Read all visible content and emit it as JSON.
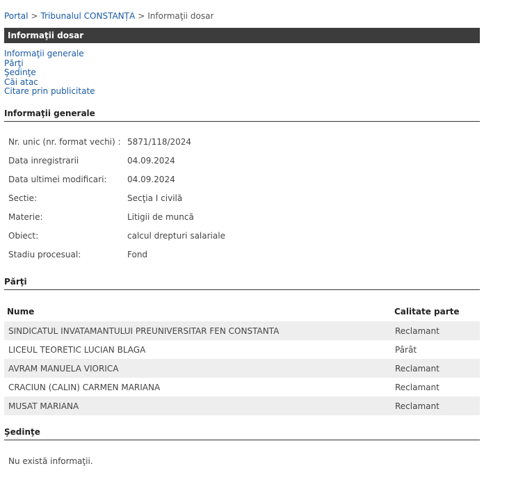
{
  "breadcrumb": {
    "portal": "Portal",
    "court": "Tribunalul CONSTANȚA",
    "current": "Informaţii dosar",
    "separator": ">"
  },
  "header": {
    "title": "Informaţii dosar"
  },
  "toc": [
    {
      "label": "Informaţii generale"
    },
    {
      "label": "Părţi"
    },
    {
      "label": "Şedinţe"
    },
    {
      "label": "Căi atac"
    },
    {
      "label": "Citare prin publicitate"
    }
  ],
  "sections": {
    "info_title": "Informaţii generale",
    "parti_title": "Părţi",
    "sedinte_title": "Şedinţe"
  },
  "info": [
    {
      "label": "Nr. unic (nr. format vechi) :",
      "value": "5871/118/2024"
    },
    {
      "label": "Data inregistrarii",
      "value": "04.09.2024"
    },
    {
      "label": "Data ultimei modificari:",
      "value": "04.09.2024"
    },
    {
      "label": "Sectie:",
      "value": "Secţia I civilă"
    },
    {
      "label": "Materie:",
      "value": "Litigii de muncă"
    },
    {
      "label": "Obiect:",
      "value": "calcul drepturi salariale"
    },
    {
      "label": "Stadiu procesual:",
      "value": "Fond"
    }
  ],
  "parti": {
    "columns": {
      "name": "Nume",
      "role": "Calitate parte"
    },
    "rows": [
      {
        "name": "SINDICATUL INVATAMANTULUI PREUNIVERSITAR FEN CONSTANTA",
        "role": "Reclamant"
      },
      {
        "name": "LICEUL TEORETIC LUCIAN BLAGA",
        "role": "Pârât"
      },
      {
        "name": "AVRAM MANUELA VIORICA",
        "role": "Reclamant"
      },
      {
        "name": "CRACIUN (CALIN) CARMEN MARIANA",
        "role": "Reclamant"
      },
      {
        "name": "MUSAT MARIANA",
        "role": "Reclamant"
      }
    ]
  },
  "sedinte": {
    "empty_text": "Nu există informaţii."
  }
}
